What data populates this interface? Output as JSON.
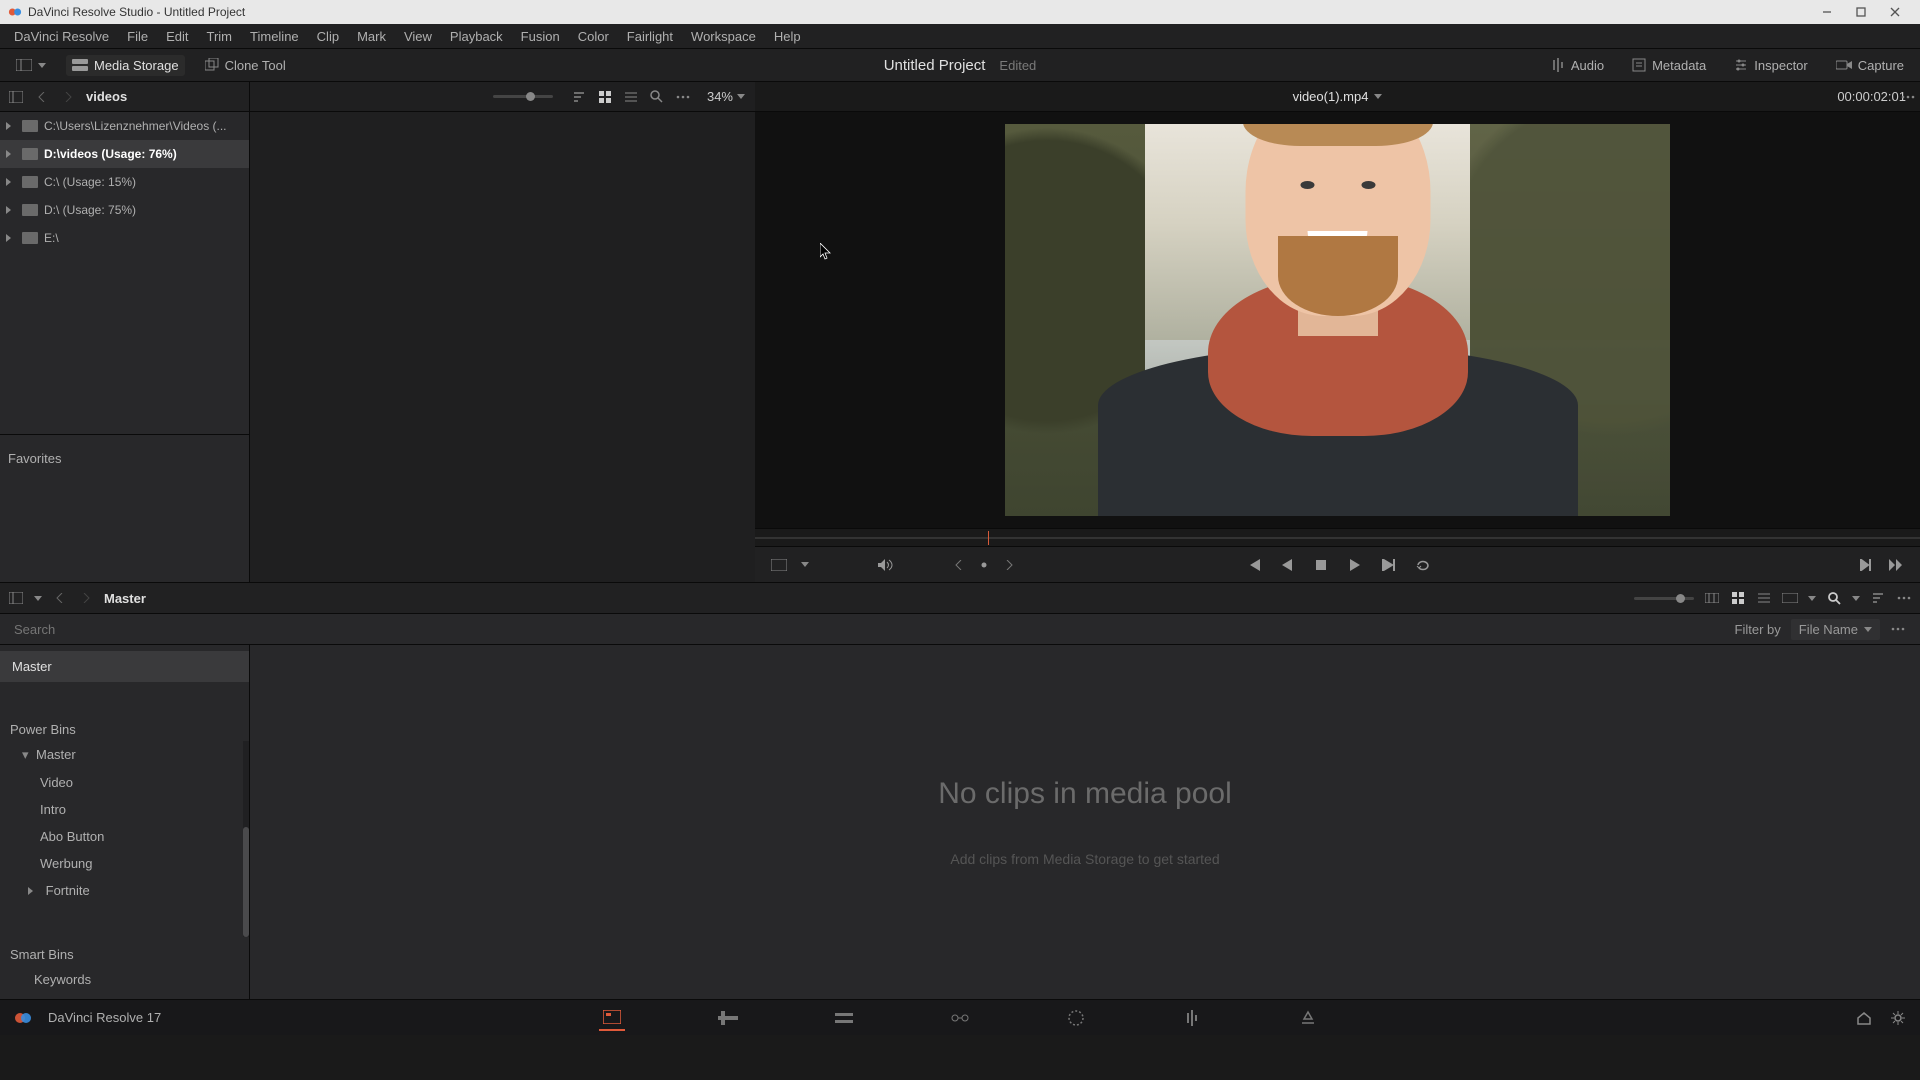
{
  "window": {
    "title": "DaVinci Resolve Studio - Untitled Project"
  },
  "menu": {
    "items": [
      "DaVinci Resolve",
      "File",
      "Edit",
      "Trim",
      "Timeline",
      "Clip",
      "Mark",
      "View",
      "Playback",
      "Fusion",
      "Color",
      "Fairlight",
      "Workspace",
      "Help"
    ]
  },
  "toolbar": {
    "media_storage": "Media Storage",
    "clone_tool": "Clone Tool",
    "project_title": "Untitled Project",
    "edited": "Edited",
    "audio": "Audio",
    "metadata": "Metadata",
    "inspector": "Inspector",
    "capture": "Capture"
  },
  "storage": {
    "breadcrumb": "videos",
    "rows": [
      {
        "label": "C:\\Users\\Lizenznehmer\\Videos (...",
        "current": false
      },
      {
        "label": "D:\\videos (Usage: 76%)",
        "current": true
      },
      {
        "label": "C:\\ (Usage: 15%)",
        "current": false
      },
      {
        "label": "D:\\ (Usage: 75%)",
        "current": false
      },
      {
        "label": "E:\\",
        "current": false
      }
    ],
    "favorites": "Favorites"
  },
  "thumbs": {
    "zoom": "34%"
  },
  "viewer": {
    "clip_name": "video(1).mp4",
    "timecode": "00:00:02:01"
  },
  "pool": {
    "master": "Master",
    "search_placeholder": "Search",
    "filter_by_label": "Filter by",
    "filter_by_value": "File Name",
    "bins": {
      "master": "Master",
      "power_label": "Power Bins",
      "power_master": "Master",
      "power_items": [
        "Video",
        "Intro",
        "Abo Button",
        "Werbung",
        "Fortnite"
      ],
      "smart_label": "Smart Bins",
      "smart_items": [
        "Keywords"
      ]
    },
    "empty_big": "No clips in media pool",
    "empty_small": "Add clips from Media Storage to get started"
  },
  "bottom": {
    "app": "DaVinci Resolve 17",
    "pages": [
      "media",
      "cut",
      "edit",
      "fusion",
      "color",
      "fairlight",
      "deliver"
    ]
  }
}
